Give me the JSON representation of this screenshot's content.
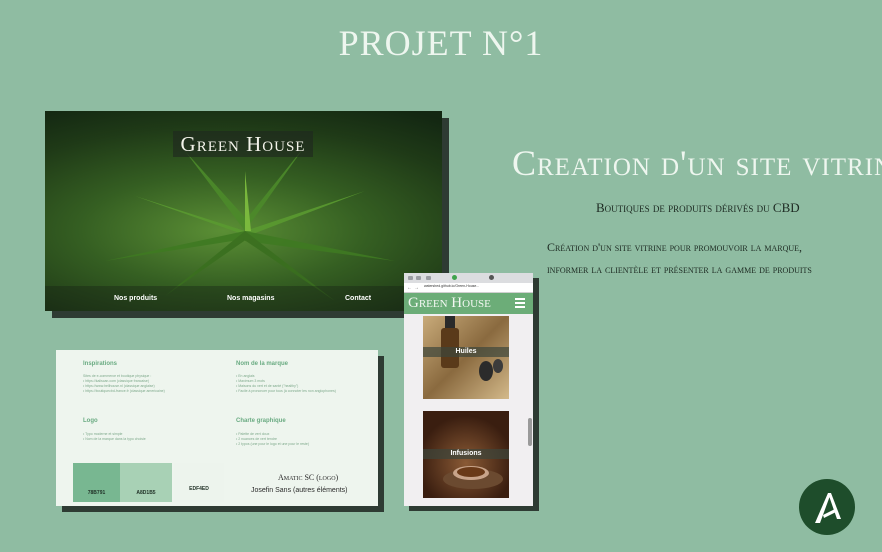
{
  "page_title": "PROJET N°1",
  "hero": {
    "brand": "Green House",
    "nav": [
      "Nos produits",
      "Nos magasins",
      "Contact"
    ]
  },
  "right": {
    "heading": "Creation d'un site vitrine",
    "subtitle": "Boutiques de produits dérivés du CBD",
    "desc_line1": "Création d'un site vitrine pour promouvoir la marque,",
    "desc_line2": "informer la clientèle et présenter la gamme de produits"
  },
  "card": {
    "inspirations_title": "Inspirations",
    "inspirations_items": [
      "Sites de e-commerce et boutique physique :",
      "• https://kaliscan.com (classique francaise)",
      "• https://www.hellhouse.nl (classique anglaise)",
      "• https://boutiquecbd-france.fr (classique americaine)"
    ],
    "brand_title": "Nom de la marque",
    "brand_items": [
      "• En anglais",
      "• Maximum 3 mots",
      "• Maisons du vert et de santé (\"healthy\")",
      "• Facile à prononcer pour tous (à connoter les non anglophones)"
    ],
    "logo_title": "Logo",
    "logo_items": [
      "• Typo moderne et simple",
      "• Nom de la marque dans la typo choisie"
    ],
    "charte_title": "Charte graphique",
    "charte_items": [
      "• Palette de vert doux",
      "• 2 nuances de vert tendre",
      "• 2 typos (une pour le logo et une pour le reste)"
    ],
    "swatches": [
      {
        "hex": "#78B791",
        "label": "78B791"
      },
      {
        "hex": "#A8D1B5",
        "label": "A8D1B5"
      },
      {
        "hex": "#EDF4ED",
        "label": "EDF4ED"
      }
    ],
    "font_logo": "Amatic SC (logo)",
    "font_other": "Josefin Sans (autres éléments)"
  },
  "phone": {
    "url": "watershed.github.io/Green-House...",
    "brand": "Green House",
    "products": [
      "Huiles",
      "Infusions"
    ]
  },
  "colors": {
    "background": "#8fbca2",
    "phone_header": "#6cad78",
    "logo_bg": "#1e4d2b"
  }
}
